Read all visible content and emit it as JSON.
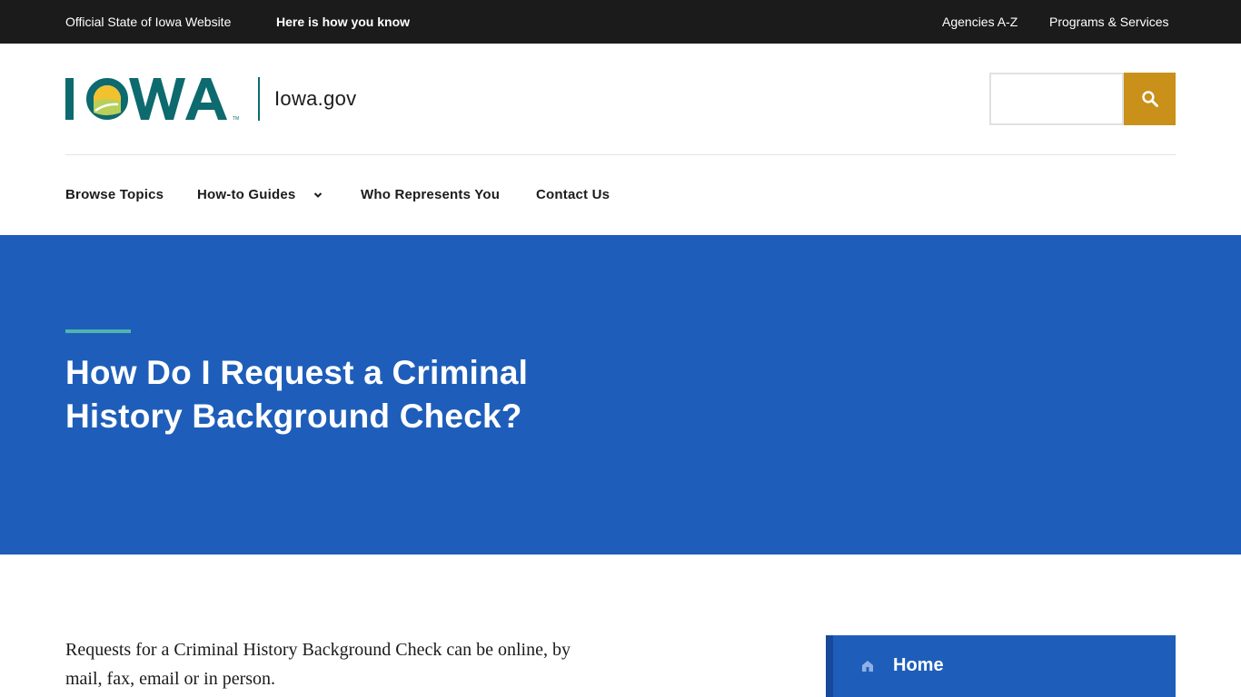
{
  "topbar": {
    "official_label": "Official State of Iowa Website",
    "how_you_know_label": "Here is how you know",
    "agencies_label": "Agencies A-Z",
    "programs_label": "Programs & Services"
  },
  "header": {
    "logo_text": "IOWA",
    "site_name": "Iowa.gov",
    "search": {
      "placeholder": "",
      "value": ""
    }
  },
  "nav": {
    "items": [
      {
        "label": "Browse Topics"
      },
      {
        "label": "How-to Guides",
        "has_dropdown": true
      },
      {
        "label": "Who Represents You"
      },
      {
        "label": "Contact Us"
      }
    ]
  },
  "hero": {
    "title_line1": "How Do I Request a Criminal",
    "title_line2": "History Background Check?"
  },
  "content": {
    "intro_line1": "Requests for a Criminal History Background Check can be online, by",
    "intro_line2": "mail, fax, email or in person."
  },
  "sidebar": {
    "home_label": "Home"
  },
  "icons": {
    "search": "search-icon",
    "chevron": "chevron-down-icon",
    "home": "home-icon"
  },
  "colors": {
    "topbar_bg": "#1b1b1b",
    "hero_blue": "#1e5eba",
    "search_button": "#c9901a",
    "accent_teal": "#4fb3b0",
    "logo_teal": "#0d6a6e"
  }
}
